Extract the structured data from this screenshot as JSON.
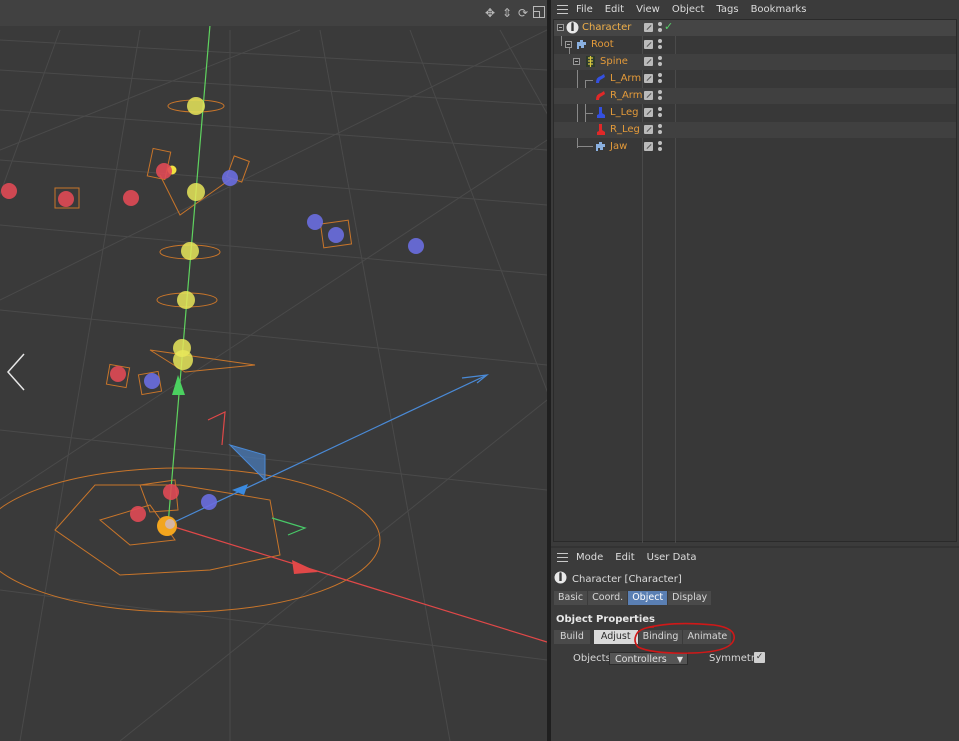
{
  "object_manager": {
    "menu": [
      "File",
      "Edit",
      "View",
      "Object",
      "Tags",
      "Bookmarks"
    ],
    "tree": [
      {
        "label": "Character",
        "icon": "character-icon",
        "depth": 0,
        "checked": true
      },
      {
        "label": "Root",
        "icon": "puzzle-icon",
        "depth": 1
      },
      {
        "label": "Spine",
        "icon": "spine-icon",
        "depth": 2
      },
      {
        "label": "L_Arm",
        "icon": "arm-icon",
        "depth": 3
      },
      {
        "label": "R_Arm",
        "icon": "arm-icon",
        "depth": 3
      },
      {
        "label": "L_Leg",
        "icon": "leg-icon",
        "depth": 3
      },
      {
        "label": "R_Leg",
        "icon": "leg-icon",
        "depth": 3
      },
      {
        "label": "Jaw",
        "icon": "puzzle-icon",
        "depth": 2
      }
    ]
  },
  "attribute_manager": {
    "menu": [
      "Mode",
      "Edit",
      "User Data"
    ],
    "object_title": "Character [Character]",
    "tabs": [
      "Basic",
      "Coord.",
      "Object",
      "Display"
    ],
    "active_tab": "Object",
    "section_title": "Object Properties",
    "subtabs": [
      "Build",
      "Adjust",
      "Binding",
      "Animate"
    ],
    "active_subtab": "Adjust",
    "objects_label": "Objects",
    "objects_value": "Controllers",
    "symmetry_label": "Symmetry",
    "symmetry_checked": true
  },
  "colors": {
    "accent_tab": "#5a7fb3",
    "tree_label": "#e39a3a",
    "annotation": "#d01818",
    "joint_yellow": "#e8e65a",
    "joint_red": "#e04a55",
    "joint_blue": "#6a6ee0"
  },
  "icons": {
    "move": "move-icon",
    "pan": "pan-icon",
    "rotate": "rotate-icon",
    "maximize": "maximize-icon",
    "prev": "chevron-left-icon",
    "next": "chevron-right-icon"
  }
}
